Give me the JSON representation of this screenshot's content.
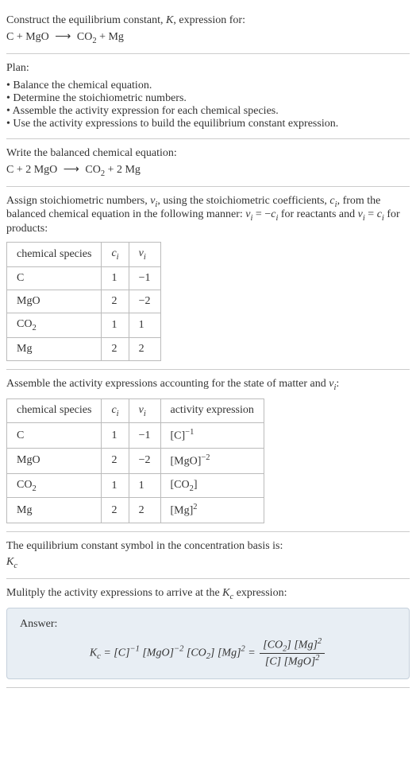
{
  "intro": {
    "line1": "Construct the equilibrium constant, ",
    "K": "K",
    "line1b": ", expression for:",
    "eq_left": "C + MgO",
    "eq_right": "CO",
    "eq_right_sub": "2",
    "eq_right_b": " + Mg"
  },
  "plan": {
    "title": "Plan:",
    "items": [
      "Balance the chemical equation.",
      "Determine the stoichiometric numbers.",
      "Assemble the activity expression for each chemical species.",
      "Use the activity expressions to build the equilibrium constant expression."
    ]
  },
  "balanced": {
    "title": "Write the balanced chemical equation:",
    "left": "C + 2 MgO",
    "right_a": "CO",
    "right_sub": "2",
    "right_b": " + 2 Mg"
  },
  "stoich": {
    "intro_a": "Assign stoichiometric numbers, ",
    "nu": "ν",
    "sub_i": "i",
    "intro_b": ", using the stoichiometric coefficients, ",
    "c": "c",
    "intro_c": ", from the balanced chemical equation in the following manner: ",
    "rule_a": " = −",
    "intro_d": " for reactants and ",
    "rule_b": " = ",
    "intro_e": " for products:",
    "header_species": "chemical species",
    "header_c": "c",
    "header_nu": "ν",
    "header_sub": "i",
    "rows": [
      {
        "species": "C",
        "c": "1",
        "nu": "−1"
      },
      {
        "species": "MgO",
        "c": "2",
        "nu": "−2"
      },
      {
        "species_a": "CO",
        "species_sub": "2",
        "c": "1",
        "nu": "1"
      },
      {
        "species": "Mg",
        "c": "2",
        "nu": "2"
      }
    ]
  },
  "activity": {
    "intro_a": "Assemble the activity expressions accounting for the state of matter and ",
    "nu": "ν",
    "sub_i": "i",
    "intro_b": ":",
    "header_species": "chemical species",
    "header_c": "c",
    "header_nu": "ν",
    "header_sub": "i",
    "header_activity": "activity expression",
    "rows": {
      "r0": {
        "species": "C",
        "c": "1",
        "nu": "−1",
        "act_a": "[C]",
        "exp": "−1"
      },
      "r1": {
        "species": "MgO",
        "c": "2",
        "nu": "−2",
        "act_a": "[MgO]",
        "exp": "−2"
      },
      "r2": {
        "species_a": "CO",
        "species_sub": "2",
        "c": "1",
        "nu": "1",
        "act_a": "[CO",
        "act_sub": "2",
        "act_b": "]"
      },
      "r3": {
        "species": "Mg",
        "c": "2",
        "nu": "2",
        "act_a": "[Mg]",
        "exp": "2"
      }
    }
  },
  "symbol": {
    "line1": "The equilibrium constant symbol in the concentration basis is:",
    "K": "K",
    "sub": "c"
  },
  "final": {
    "line1_a": "Mulitply the activity expressions to arrive at the ",
    "K": "K",
    "sub": "c",
    "line1_b": " expression:",
    "answer_label": "Answer:",
    "Kc": "K",
    "Kc_sub": "c",
    "eq": " = ",
    "t1": "[C]",
    "e1": "−1",
    "t2": " [MgO]",
    "e2": "−2",
    "t3": " [CO",
    "t3sub": "2",
    "t3b": "] [Mg]",
    "e3": "2",
    "num_a": "[CO",
    "num_sub": "2",
    "num_b": "] [Mg]",
    "num_exp": "2",
    "den_a": "[C] [MgO]",
    "den_exp": "2"
  }
}
